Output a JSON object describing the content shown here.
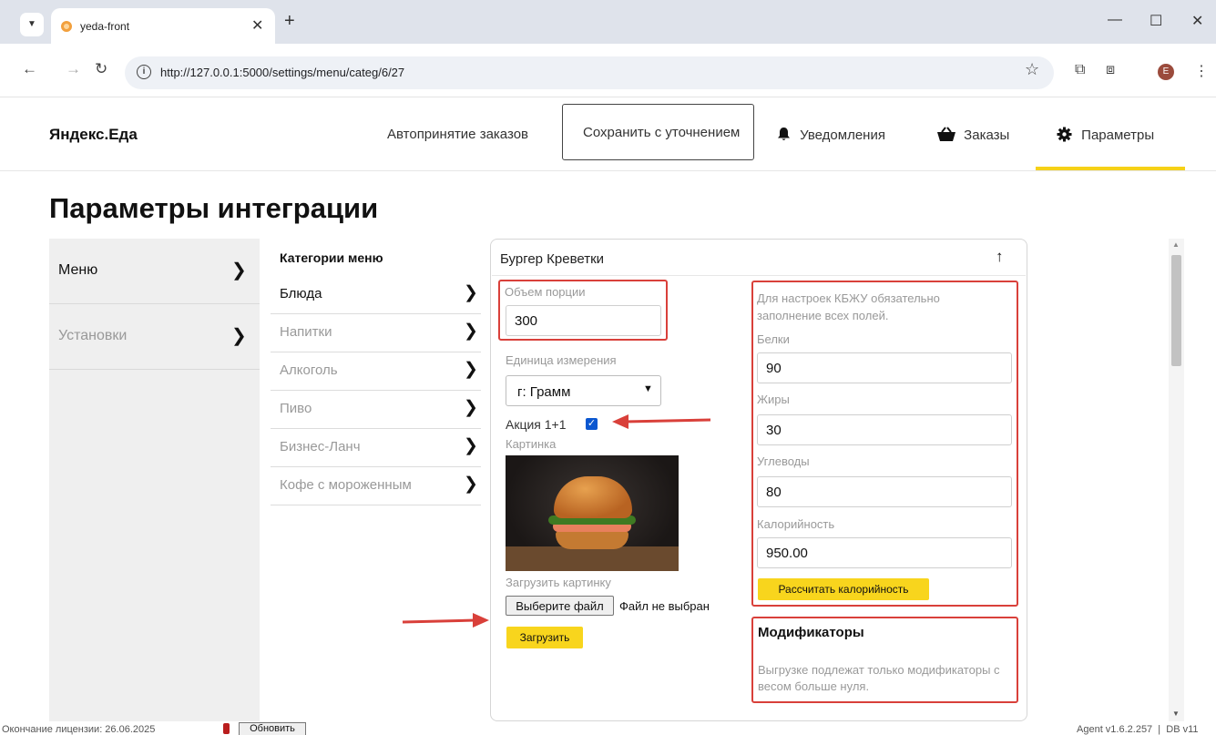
{
  "browser": {
    "tab_title": "yeda-front",
    "url": "http://127.0.0.1:5000/settings/menu/categ/6/27",
    "profile_initial": "E"
  },
  "header": {
    "brand": "Яндекс.Еда",
    "auto_accept": "Автопринятие заказов",
    "save_button": "Сохранить с уточнением",
    "nav": [
      {
        "label": "Уведомления",
        "icon": "bell-icon"
      },
      {
        "label": "Заказы",
        "icon": "basket-icon"
      },
      {
        "label": "Параметры",
        "icon": "gear-icon"
      }
    ]
  },
  "page": {
    "title": "Параметры интеграции"
  },
  "sidebar": {
    "items": [
      {
        "label": "Меню"
      },
      {
        "label": "Установки"
      }
    ]
  },
  "categories": {
    "header": "Категории меню",
    "items": [
      {
        "label": "Блюда"
      },
      {
        "label": "Напитки"
      },
      {
        "label": "Алкоголь"
      },
      {
        "label": "Пиво"
      },
      {
        "label": "Бизнес-Ланч"
      },
      {
        "label": "Кофе с мороженным"
      }
    ]
  },
  "card": {
    "title": "Бургер Креветки",
    "portion": {
      "label": "Объем порции",
      "value": "300"
    },
    "unit": {
      "label": "Единица измерения",
      "value": "г: Грамм"
    },
    "promo": {
      "label": "Акция 1+1",
      "checked": true
    },
    "picture_label": "Картинка",
    "upload_label": "Загрузить картинку",
    "choose_file": "Выберите файл",
    "no_file": "Файл не выбран",
    "upload_button": "Загрузить",
    "kbju_note": "Для настроек КБЖУ обязательно заполнение всех полей.",
    "proteins": {
      "label": "Белки",
      "value": "90"
    },
    "fats": {
      "label": "Жиры",
      "value": "30"
    },
    "carbs": {
      "label": "Углеводы",
      "value": "80"
    },
    "calories": {
      "label": "Калорийность",
      "value": "950.00"
    },
    "calc_button": "Рассчитать калорийность",
    "modifiers_title": "Модификаторы",
    "modifiers_note": "Выгрузке подлежат только модификаторы с весом больше нуля."
  },
  "footer": {
    "license": "Окончание лицензии: 26.06.2025",
    "refresh": "Обновить",
    "version": "Agent v1.6.2.257  |  DB v11"
  },
  "colors": {
    "accent_yellow": "#f8d51d",
    "annotation_red": "#d9403a",
    "checkbox_blue": "#0b57d0"
  }
}
